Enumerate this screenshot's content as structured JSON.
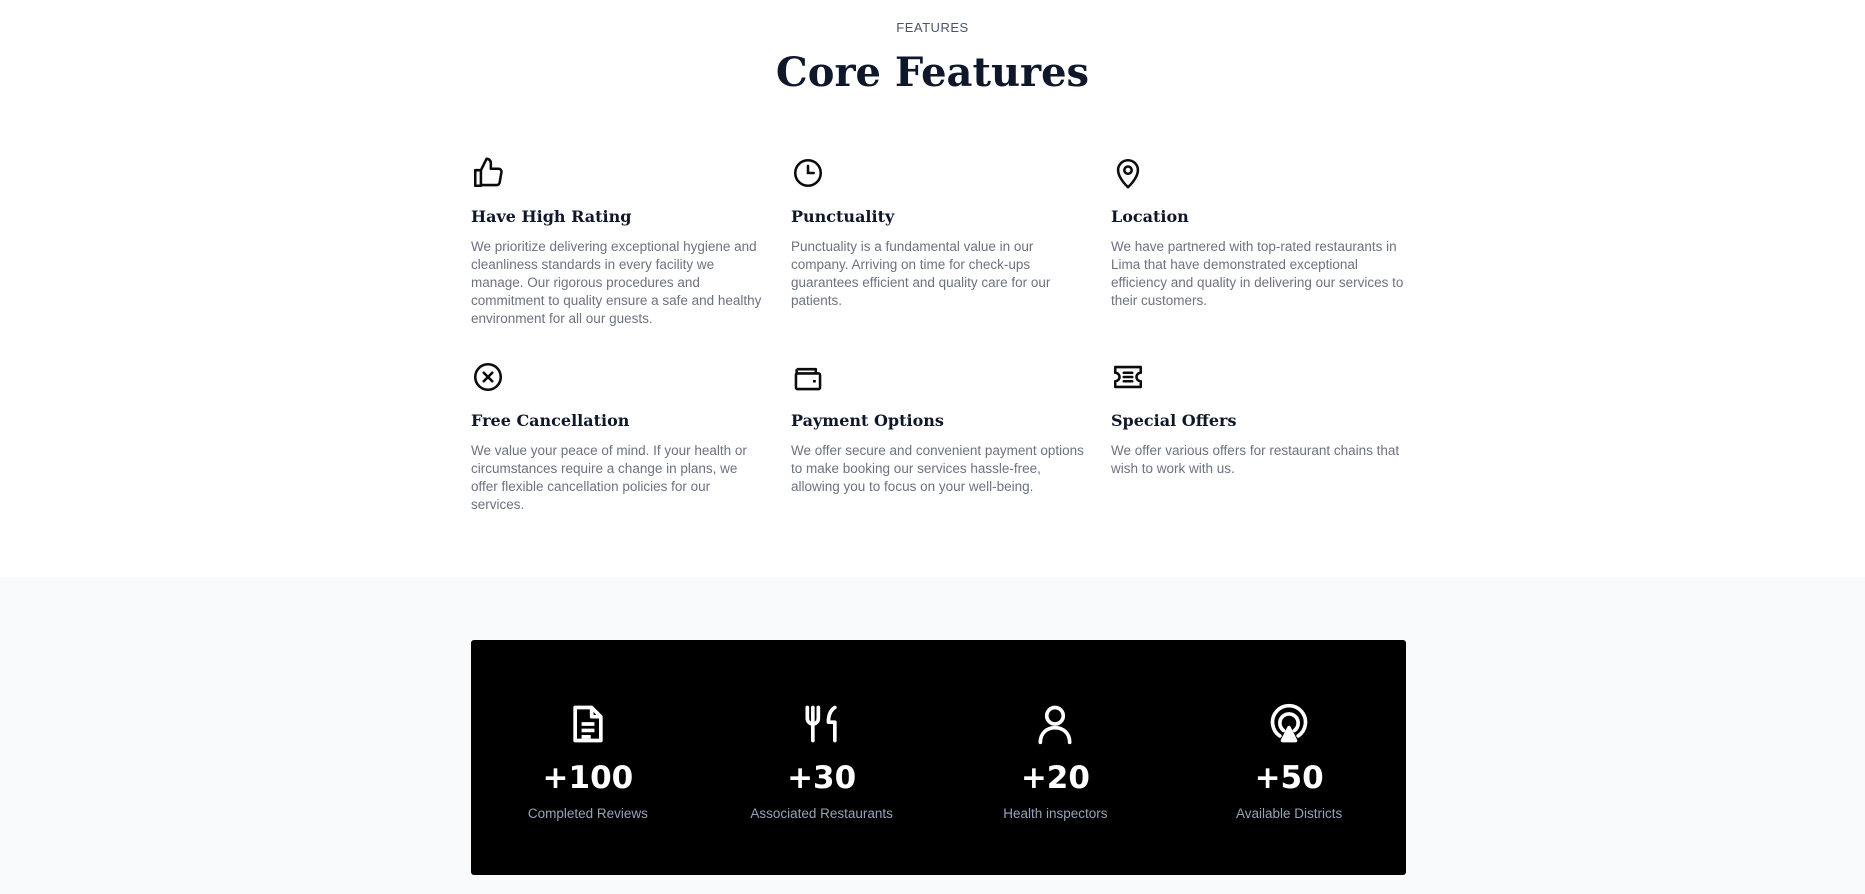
{
  "features": {
    "eyebrow": "FEATURES",
    "title": "Core Features",
    "items": [
      {
        "icon": "thumbs-up-icon",
        "title": "Have High Rating",
        "text": "We prioritize delivering exceptional hygiene and cleanliness standards in every facility we manage. Our rigorous procedures and commitment to quality ensure a safe and healthy environment for all our guests."
      },
      {
        "icon": "clock-icon",
        "title": "Punctuality",
        "text": "Punctuality is a fundamental value in our company. Arriving on time for check-ups guarantees efficient and quality care for our patients."
      },
      {
        "icon": "map-pin-icon",
        "title": "Location",
        "text": "We have partnered with top-rated restaurants in Lima that have demonstrated exceptional efficiency and quality in delivering our services to their customers."
      },
      {
        "icon": "x-circle-icon",
        "title": "Free Cancellation",
        "text": "We value your peace of mind. If your health or circumstances require a change in plans, we offer flexible cancellation policies for our services."
      },
      {
        "icon": "wallet-icon",
        "title": "Payment Options",
        "text": "We offer secure and convenient payment options to make booking our services hassle-free, allowing you to focus on your well-being."
      },
      {
        "icon": "ticket-icon",
        "title": "Special Offers",
        "text": "We offer various offers for restaurant chains that wish to work with us."
      }
    ]
  },
  "stats": {
    "items": [
      {
        "icon": "document-icon",
        "value": "+100",
        "label": "Completed Reviews"
      },
      {
        "icon": "fork-knife-icon",
        "value": "+30",
        "label": "Associated Restaurants"
      },
      {
        "icon": "user-icon",
        "value": "+20",
        "label": "Health inspectors"
      },
      {
        "icon": "broadcast-icon",
        "value": "+50",
        "label": "Available Districts"
      }
    ]
  }
}
